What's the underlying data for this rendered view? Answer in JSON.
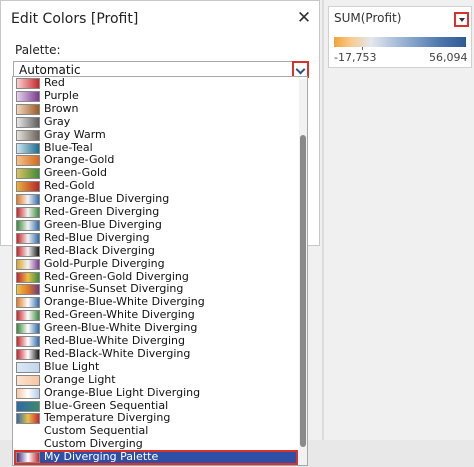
{
  "dialog": {
    "title": "Edit Colors [Profit]",
    "palette_label": "Palette:",
    "selected_value": "Automatic"
  },
  "palettes": [
    {
      "label": "Red",
      "colors": [
        "#f9d2cf",
        "#c8262b"
      ]
    },
    {
      "label": "Purple",
      "colors": [
        "#e6d1ea",
        "#7b3a8f"
      ]
    },
    {
      "label": "Brown",
      "colors": [
        "#f0d8c0",
        "#9b5a25"
      ]
    },
    {
      "label": "Gray",
      "colors": [
        "#e8e8e8",
        "#5c5c5c"
      ]
    },
    {
      "label": "Gray Warm",
      "colors": [
        "#e6e2dc",
        "#6b625a"
      ]
    },
    {
      "label": "Blue-Teal",
      "colors": [
        "#cfe6f0",
        "#1d6b8e"
      ]
    },
    {
      "label": "Orange-Gold",
      "colors": [
        "#f5c28a",
        "#d26a1c"
      ]
    },
    {
      "label": "Green-Gold",
      "colors": [
        "#d9c35e",
        "#3f8a3a"
      ]
    },
    {
      "label": "Red-Gold",
      "colors": [
        "#e8b23a",
        "#b8262b"
      ]
    },
    {
      "label": "Orange-Blue Diverging",
      "colors": [
        "#e07b27",
        "#f3f3f3",
        "#2f6aa8"
      ]
    },
    {
      "label": "Red-Green Diverging",
      "colors": [
        "#c8262b",
        "#f3f3f3",
        "#3b8a3e"
      ]
    },
    {
      "label": "Green-Blue Diverging",
      "colors": [
        "#3b8a3e",
        "#f3f3f3",
        "#2f6aa8"
      ]
    },
    {
      "label": "Red-Blue Diverging",
      "colors": [
        "#c8262b",
        "#f3f3f3",
        "#2f6aa8"
      ]
    },
    {
      "label": "Red-Black Diverging",
      "colors": [
        "#c8262b",
        "#f3f3f3",
        "#1a1a1a"
      ]
    },
    {
      "label": "Gold-Purple Diverging",
      "colors": [
        "#d8a32a",
        "#f3f3f3",
        "#7b3a8f"
      ]
    },
    {
      "label": "Red-Green-Gold Diverging",
      "colors": [
        "#c8262b",
        "#e8c24a",
        "#3b8a3e"
      ]
    },
    {
      "label": "Sunrise-Sunset Diverging",
      "colors": [
        "#e8c24a",
        "#e07b27",
        "#6b3a7a"
      ]
    },
    {
      "label": "Orange-Blue-White Diverging",
      "colors": [
        "#e07b27",
        "#ffffff",
        "#2f6aa8"
      ]
    },
    {
      "label": "Red-Green-White Diverging",
      "colors": [
        "#c8262b",
        "#ffffff",
        "#3b8a3e"
      ]
    },
    {
      "label": "Green-Blue-White Diverging",
      "colors": [
        "#3b8a3e",
        "#ffffff",
        "#2f6aa8"
      ]
    },
    {
      "label": "Red-Blue-White Diverging",
      "colors": [
        "#c8262b",
        "#ffffff",
        "#2f6aa8"
      ]
    },
    {
      "label": "Red-Black-White Diverging",
      "colors": [
        "#c8262b",
        "#ffffff",
        "#1a1a1a"
      ]
    },
    {
      "label": "Blue Light",
      "colors": [
        "#dbe8f5",
        "#c2d6ee"
      ]
    },
    {
      "label": "Orange Light",
      "colors": [
        "#fbe3cf",
        "#f5c7a3"
      ]
    },
    {
      "label": "Orange-Blue Light Diverging",
      "colors": [
        "#f5c7a3",
        "#ffffff",
        "#b5cbe8"
      ]
    },
    {
      "label": "Blue-Green Sequential",
      "colors": [
        "#2f6aa8",
        "#3b8a6a"
      ]
    },
    {
      "label": "Temperature Diverging",
      "colors": [
        "#2f6aa8",
        "#e8c24a",
        "#c8262b"
      ]
    },
    {
      "label": "Custom Sequential",
      "colors": []
    },
    {
      "label": "Custom Diverging",
      "colors": []
    },
    {
      "label": "My Diverging Palette",
      "colors": [
        "#4a2a7a",
        "#ffffff",
        "#c8262b"
      ],
      "selected": true
    }
  ],
  "legend": {
    "title": "SUM(Profit)",
    "min": "-17,753",
    "max": "56,094",
    "gradient_colors": [
      "#f2a33a",
      "#e4e8ef",
      "#2f5a94"
    ]
  },
  "colors": {
    "highlight": "#d9312b",
    "selection": "#2f4fa6"
  }
}
